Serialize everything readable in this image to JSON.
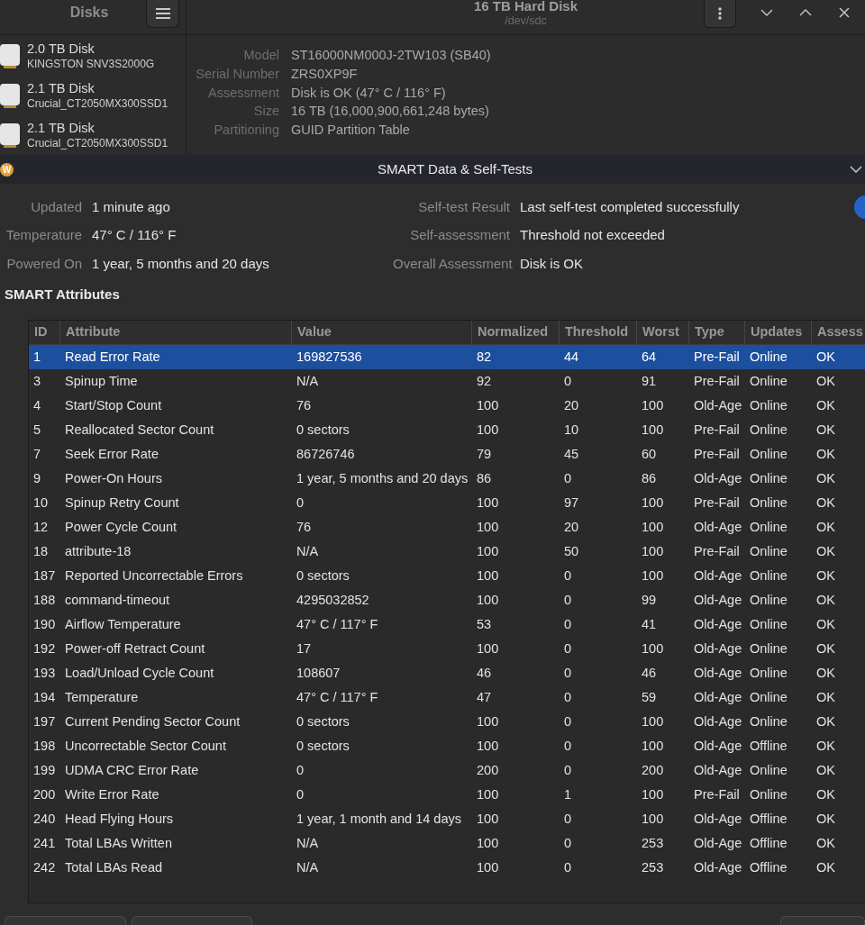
{
  "main_window": {
    "sidebar": {
      "title": "Disks",
      "disks": [
        {
          "name": "2.0 TB Disk",
          "model": "KINGSTON SNV3S2000G"
        },
        {
          "name": "2.1 TB Disk",
          "model": "Crucial_CT2050MX300SSD1"
        },
        {
          "name": "2.1 TB Disk",
          "model": "Crucial_CT2050MX300SSD1"
        }
      ]
    },
    "header": {
      "title": "16 TB Hard Disk",
      "subtitle": "/dev/sdc"
    },
    "details": [
      {
        "label": "Model",
        "value": "ST16000NM000J-2TW103 (SB40)"
      },
      {
        "label": "Serial Number",
        "value": "ZRS0XP9F"
      },
      {
        "label": "Assessment",
        "value": "Disk is OK (47° C / 116° F)"
      },
      {
        "label": "Size",
        "value": "16 TB (16,000,900,661,248 bytes)"
      },
      {
        "label": "Partitioning",
        "value": "GUID Partition Table"
      }
    ]
  },
  "dialog": {
    "logo_letter": "W",
    "title": "SMART Data & Self-Tests",
    "summary": [
      {
        "label": "Updated",
        "value": "1 minute ago"
      },
      {
        "label": "Temperature",
        "value": "47° C / 116° F"
      },
      {
        "label": "Powered On",
        "value": "1 year, 5 months and 20 days"
      }
    ],
    "self_test": [
      {
        "label": "Self-test Result",
        "value": "Last self-test completed successfully"
      },
      {
        "label": "Self-assessment",
        "value": "Threshold not exceeded"
      },
      {
        "label": "Overall Assessment",
        "value": "Disk is OK"
      }
    ],
    "section_title": "SMART Attributes",
    "table": {
      "columns": [
        "ID",
        "Attribute",
        "Value",
        "Normalized",
        "Threshold",
        "Worst",
        "Type",
        "Updates",
        "Assess"
      ],
      "rows": [
        {
          "selected": true,
          "cells": [
            "1",
            "Read Error Rate",
            "169827536",
            "82",
            "44",
            "64",
            "Pre-Fail",
            "Online",
            "OK"
          ]
        },
        {
          "selected": false,
          "cells": [
            "3",
            "Spinup Time",
            "N/A",
            "92",
            "0",
            "91",
            "Pre-Fail",
            "Online",
            "OK"
          ]
        },
        {
          "selected": false,
          "cells": [
            "4",
            "Start/Stop Count",
            "76",
            "100",
            "20",
            "100",
            "Old-Age",
            "Online",
            "OK"
          ]
        },
        {
          "selected": false,
          "cells": [
            "5",
            "Reallocated Sector Count",
            "0 sectors",
            "100",
            "10",
            "100",
            "Pre-Fail",
            "Online",
            "OK"
          ]
        },
        {
          "selected": false,
          "cells": [
            "7",
            "Seek Error Rate",
            "86726746",
            "79",
            "45",
            "60",
            "Pre-Fail",
            "Online",
            "OK"
          ]
        },
        {
          "selected": false,
          "cells": [
            "9",
            "Power-On Hours",
            "1 year, 5 months and 20 days",
            "86",
            "0",
            "86",
            "Old-Age",
            "Online",
            "OK"
          ]
        },
        {
          "selected": false,
          "cells": [
            "10",
            "Spinup Retry Count",
            "0",
            "100",
            "97",
            "100",
            "Pre-Fail",
            "Online",
            "OK"
          ]
        },
        {
          "selected": false,
          "cells": [
            "12",
            "Power Cycle Count",
            "76",
            "100",
            "20",
            "100",
            "Old-Age",
            "Online",
            "OK"
          ]
        },
        {
          "selected": false,
          "cells": [
            "18",
            "attribute-18",
            "N/A",
            "100",
            "50",
            "100",
            "Pre-Fail",
            "Online",
            "OK"
          ]
        },
        {
          "selected": false,
          "cells": [
            "187",
            "Reported Uncorrectable Errors",
            "0 sectors",
            "100",
            "0",
            "100",
            "Old-Age",
            "Online",
            "OK"
          ]
        },
        {
          "selected": false,
          "cells": [
            "188",
            "command-timeout",
            "4295032852",
            "100",
            "0",
            "99",
            "Old-Age",
            "Online",
            "OK"
          ]
        },
        {
          "selected": false,
          "cells": [
            "190",
            "Airflow Temperature",
            "47° C / 117° F",
            "53",
            "0",
            "41",
            "Old-Age",
            "Online",
            "OK"
          ]
        },
        {
          "selected": false,
          "cells": [
            "192",
            "Power-off Retract Count",
            "17",
            "100",
            "0",
            "100",
            "Old-Age",
            "Online",
            "OK"
          ]
        },
        {
          "selected": false,
          "cells": [
            "193",
            "Load/Unload Cycle Count",
            "108607",
            "46",
            "0",
            "46",
            "Old-Age",
            "Online",
            "OK"
          ]
        },
        {
          "selected": false,
          "cells": [
            "194",
            "Temperature",
            "47° C / 117° F",
            "47",
            "0",
            "59",
            "Old-Age",
            "Online",
            "OK"
          ]
        },
        {
          "selected": false,
          "cells": [
            "197",
            "Current Pending Sector Count",
            "0 sectors",
            "100",
            "0",
            "100",
            "Old-Age",
            "Online",
            "OK"
          ]
        },
        {
          "selected": false,
          "cells": [
            "198",
            "Uncorrectable Sector Count",
            "0 sectors",
            "100",
            "0",
            "100",
            "Old-Age",
            "Offline",
            "OK"
          ]
        },
        {
          "selected": false,
          "cells": [
            "199",
            "UDMA CRC Error Rate",
            "0",
            "200",
            "0",
            "200",
            "Old-Age",
            "Online",
            "OK"
          ]
        },
        {
          "selected": false,
          "cells": [
            "200",
            "Write Error Rate",
            "0",
            "100",
            "1",
            "100",
            "Pre-Fail",
            "Online",
            "OK"
          ]
        },
        {
          "selected": false,
          "cells": [
            "240",
            "Head Flying Hours",
            "1 year, 1 month and 14 days",
            "100",
            "0",
            "100",
            "Old-Age",
            "Offline",
            "OK"
          ]
        },
        {
          "selected": false,
          "cells": [
            "241",
            "Total LBAs Written",
            "N/A",
            "100",
            "0",
            "253",
            "Old-Age",
            "Offline",
            "OK"
          ]
        },
        {
          "selected": false,
          "cells": [
            "242",
            "Total LBAs Read",
            "N/A",
            "100",
            "0",
            "253",
            "Old-Age",
            "Offline",
            "OK"
          ]
        }
      ]
    }
  }
}
